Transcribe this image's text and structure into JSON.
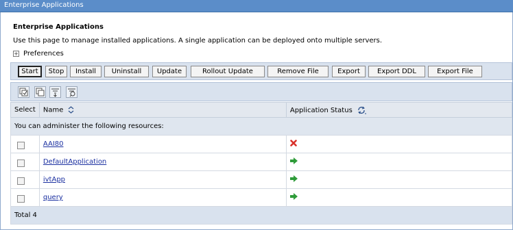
{
  "window": {
    "title": "Enterprise Applications"
  },
  "page": {
    "title": "Enterprise Applications",
    "description": "Use this page to manage installed applications. A single application can be deployed onto multiple servers.",
    "preferences_label": "Preferences"
  },
  "toolbar": {
    "buttons": [
      {
        "label": "Start"
      },
      {
        "label": "Stop"
      },
      {
        "label": "Install"
      },
      {
        "label": "Uninstall"
      },
      {
        "label": "Update"
      },
      {
        "label": "Rollout Update"
      },
      {
        "label": "Remove File"
      },
      {
        "label": "Export"
      },
      {
        "label": "Export DDL"
      },
      {
        "label": "Export File"
      }
    ]
  },
  "table": {
    "headers": {
      "select": "Select",
      "name": "Name",
      "status": "Application Status"
    },
    "resource_note": "You can administer the following resources:",
    "rows": [
      {
        "name": "AAI80",
        "status": "stopped"
      },
      {
        "name": "DefaultApplication",
        "status": "started"
      },
      {
        "name": "ivtApp",
        "status": "started"
      },
      {
        "name": "query",
        "status": "started"
      }
    ],
    "total": "Total 4"
  },
  "colors": {
    "stopped": "#d9302a",
    "started": "#2f9c3a",
    "accent": "#5b8dc9"
  }
}
